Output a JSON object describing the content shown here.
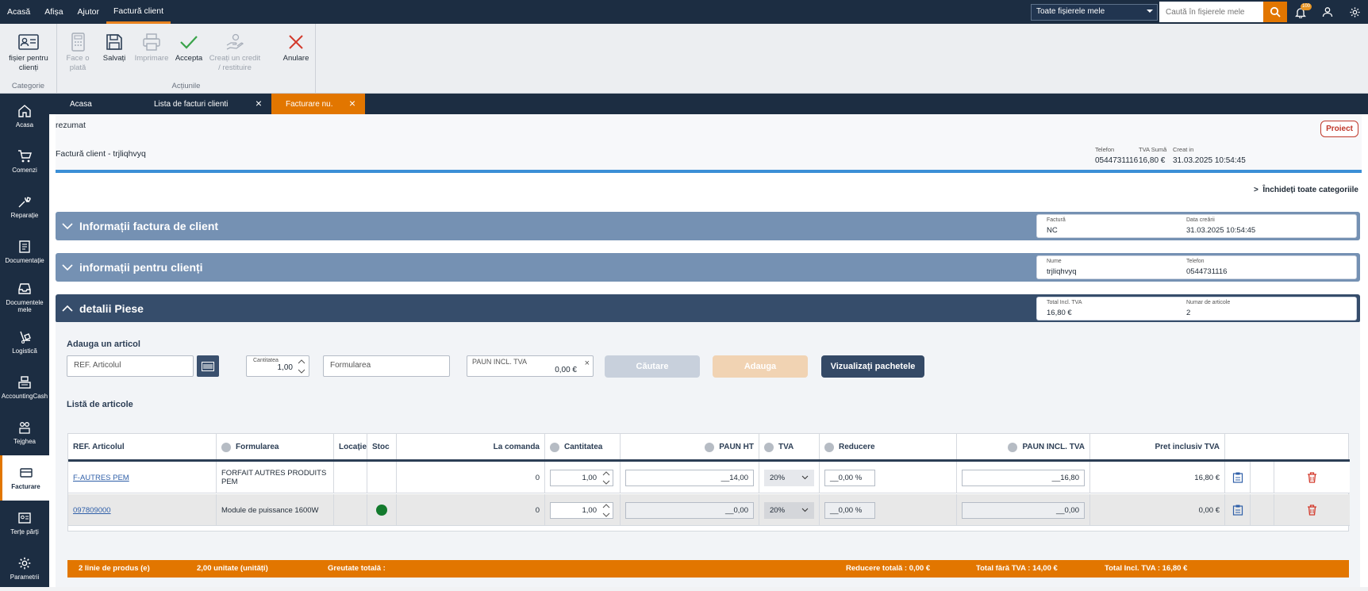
{
  "topnav": {
    "items": [
      "Acasă",
      "Afișa",
      "Ajutor",
      "Factură client"
    ]
  },
  "topright": {
    "scope": "Toate fișierele mele",
    "search_placeholder": "Caută în fișierele mele",
    "badge": "100"
  },
  "ribbon": {
    "categorie": {
      "button": "fișier pentru clienți",
      "label": "Categorie"
    },
    "actiuni": {
      "label": "Acțiunile",
      "buttons": [
        "Face o plată",
        "Salvați",
        "Imprimare",
        "Accepta",
        "Creați un credit / restituire",
        "Anulare"
      ]
    }
  },
  "sidebar": [
    "Acasa",
    "Comenzi",
    "Reparație",
    "Documentație",
    "Documentele mele",
    "Logistică",
    "AccountingCash",
    "Tejghea",
    "Facturare",
    "Terțe părți",
    "Parametrii"
  ],
  "tabs": [
    "Acasa",
    "Lista de facturi clienti",
    "Facturare nu."
  ],
  "header": {
    "summary": "rezumat",
    "title": "Factură client - trjliqhvyq",
    "badge": "Proiect",
    "meta": [
      {
        "label": "Telefon",
        "value": "0544731116"
      },
      {
        "label": "TVA Sumă",
        "value": "16,80 €"
      },
      {
        "label": "Creat in",
        "value": "31.03.2025 10:54:45"
      }
    ]
  },
  "close_all": "Închideți toate categoriile",
  "sections": [
    {
      "title": "Informații factura de client",
      "fields": [
        {
          "label": "Factură",
          "value": "NC"
        },
        {
          "label": "Data creării",
          "value": "31.03.2025 10:54:45"
        }
      ]
    },
    {
      "title": "informații pentru clienți",
      "fields": [
        {
          "label": "Nume",
          "value": "trjliqhvyq"
        },
        {
          "label": "Telefon",
          "value": "0544731116"
        }
      ]
    },
    {
      "title": "detalii Piese",
      "fields": [
        {
          "label": "Total Incl. TVA",
          "value": "16,80 €"
        },
        {
          "label": "Numar de articole",
          "value": "2"
        }
      ]
    }
  ],
  "add": {
    "title": "Adauga un articol",
    "ref_placeholder": "REF. Articolul",
    "qty_label": "Cantitatea",
    "qty_value": "1,00",
    "formulation_placeholder": "Formularea",
    "price_label": "PAUN INCL. TVA",
    "price_value": "0,00 €",
    "search_btn": "Căutare",
    "add_btn": "Adauga",
    "packages_btn": "Vizualizați pachetele"
  },
  "list": {
    "title": "Listă de articole",
    "columns": [
      "REF. Articolul",
      "Formularea",
      "Locație",
      "Stoc",
      "La comanda",
      "Cantitatea",
      "PAUN HT",
      "TVA",
      "Reducere",
      "PAUN INCL. TVA",
      "Pret inclusiv TVA"
    ],
    "rows": [
      {
        "ref": "F-AUTRES PEM",
        "formulation": "FORFAIT AUTRES PRODUITS PEM",
        "order": "0",
        "qty": "1,00",
        "ht": "__14,00",
        "tva": "20%",
        "disc": "__0,00 %",
        "incl": "__16,80",
        "total": "16,80 €",
        "stock": false
      },
      {
        "ref": "097809000",
        "formulation": "Module de puissance 1600W",
        "order": "0",
        "qty": "1,00",
        "ht": "__0,00",
        "tva": "20%",
        "disc": "__0,00 %",
        "incl": "__0,00",
        "total": "0,00 €",
        "stock": true
      }
    ]
  },
  "footer": {
    "lines": "2 linie de produs (e)",
    "units": "2,00 unitate (unități)",
    "weight": "Greutate totală :",
    "discount": "Reducere totală : 0,00 €",
    "excl": "Total fără TVA : 14,00 €",
    "incl": "Total Incl. TVA : 16,80 €"
  },
  "colors": {
    "navy": "#1c2d42",
    "orange": "#e27600",
    "section_light": "#7591b3",
    "section_dark": "#364d6b"
  }
}
